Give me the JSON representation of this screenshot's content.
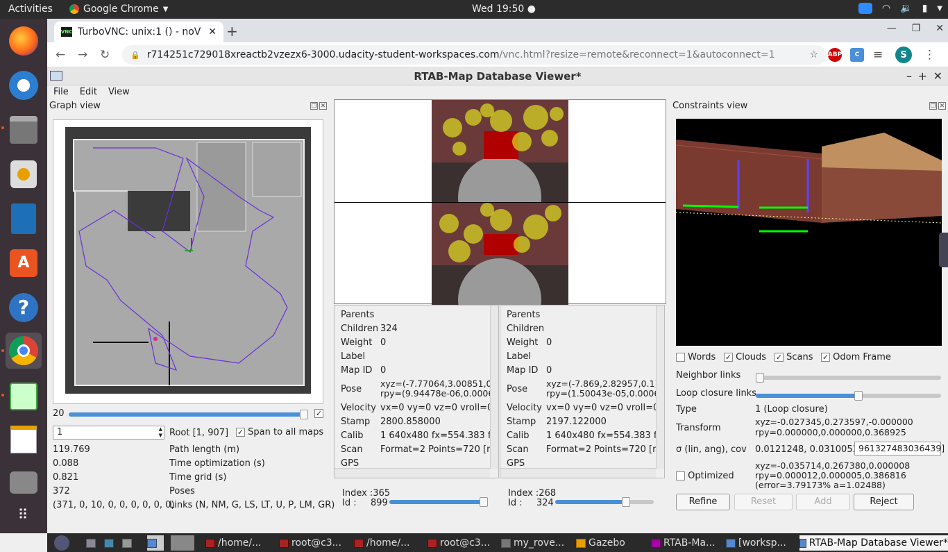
{
  "topbar": {
    "activities": "Activities",
    "app_name": "Google Chrome",
    "clock": "Wed 19:50"
  },
  "browser": {
    "tab_title": "TurboVNC: unix:1 () - noV",
    "url_host": "r714251c729018xreactb2vzezx6-3000.udacity-student-workspaces.com",
    "url_path": "/vnc.html?resize=remote&reconnect=1&autoconnect=1",
    "ext_abp": "ABP",
    "ext_c": "C",
    "profile": "S"
  },
  "app": {
    "title": "RTAB-Map Database Viewer*",
    "menu": [
      "File",
      "Edit",
      "View"
    ],
    "graph_view": {
      "title": "Graph view",
      "slider_value": "20",
      "root_input": "1",
      "root_label": "Root [1, 907]",
      "span_label": "Span to all maps",
      "stats": [
        {
          "value": "119.769",
          "label": "Path length (m)"
        },
        {
          "value": "0.088",
          "label": "Time optimization (s)"
        },
        {
          "value": "0.821",
          "label": "Time grid (s)"
        },
        {
          "value": "372",
          "label": "Poses"
        },
        {
          "value": "(371, 0, 10, 0, 0, 0, 0, 0, 0)",
          "label": "Links (N, NM, G, LS, LT, U, P, LM, GR)"
        }
      ]
    },
    "left_info": {
      "rows": [
        {
          "k": "Parents",
          "v": ""
        },
        {
          "k": "Children",
          "v": "324"
        },
        {
          "k": "Weight",
          "v": "0"
        },
        {
          "k": "Label",
          "v": ""
        },
        {
          "k": "Map ID",
          "v": "0"
        },
        {
          "k": "Pose",
          "v": "xyz=(-7.77064,3.00851,0.",
          "v2": "rpy=(9.94478e-06,0.0006"
        },
        {
          "k": "Velocity",
          "v": "vx=0 vy=0 vz=0 vroll=0 v"
        },
        {
          "k": "Stamp",
          "v": "2800.858000"
        },
        {
          "k": "Calib",
          "v": "1 640x480 fx=554.383 fy="
        },
        {
          "k": "Scan",
          "v": "Format=2 Points=720 [ma"
        },
        {
          "k": "GPS",
          "v": ""
        }
      ],
      "index": "Index :365",
      "id_label": "Id :",
      "id_value": "899"
    },
    "right_info": {
      "rows": [
        {
          "k": "Parents",
          "v": ""
        },
        {
          "k": "Children",
          "v": ""
        },
        {
          "k": "Weight",
          "v": "0"
        },
        {
          "k": "Label",
          "v": ""
        },
        {
          "k": "Map ID",
          "v": "0"
        },
        {
          "k": "Pose",
          "v": "xyz=(-7.869,2.82957,0.1)",
          "v2": "rpy=(1.50043e-05,0.0006"
        },
        {
          "k": "Velocity",
          "v": "vx=0 vy=0 vz=0 vroll=0 v"
        },
        {
          "k": "Stamp",
          "v": "2197.122000"
        },
        {
          "k": "Calib",
          "v": "1 640x480 fx=554.383 fy="
        },
        {
          "k": "Scan",
          "v": "Format=2 Points=720 [ma"
        },
        {
          "k": "GPS",
          "v": ""
        }
      ],
      "index": "Index :268",
      "id_label": "Id :",
      "id_value": "324"
    },
    "constraints": {
      "title": "Constraints view",
      "checks": [
        {
          "label": "Words",
          "checked": false
        },
        {
          "label": "Clouds",
          "checked": true
        },
        {
          "label": "Scans",
          "checked": true
        },
        {
          "label": "Odom Frame",
          "checked": true
        }
      ],
      "neighbor_links": "Neighbor links",
      "loop_closure_links": "Loop closure links",
      "type_label": "Type",
      "type_value": "1  (Loop closure)",
      "transform_label": "Transform",
      "transform_xyz": "xyz=-0.027345,0.273597,-0.000000",
      "transform_rpy": "rpy=0.000000,0.000000,0.368925",
      "sigma_label": "σ (lin, ang), cov",
      "sigma_value": "0.0121248, 0.0310053",
      "cov_value": "961327483036439]",
      "optimized_label": "Optimized",
      "opt_xyz": "xyz=-0.035714,0.267380,0.000008",
      "opt_rpy": "rpy=0.000012,0.000005,0.386816",
      "opt_err": "(error=3.79173% a=1.02488)",
      "buttons": {
        "refine": "Refine",
        "reset": "Reset",
        "add": "Add",
        "reject": "Reject"
      }
    }
  },
  "taskbar": [
    {
      "label": "/home/..."
    },
    {
      "label": "root@c3..."
    },
    {
      "label": "/home/..."
    },
    {
      "label": "root@c3..."
    },
    {
      "label": "my_rove..."
    },
    {
      "label": "Gazebo"
    },
    {
      "label": "RTAB-Ma..."
    },
    {
      "label": "[worksp..."
    },
    {
      "label": "RTAB-Map Database Viewer*"
    }
  ]
}
